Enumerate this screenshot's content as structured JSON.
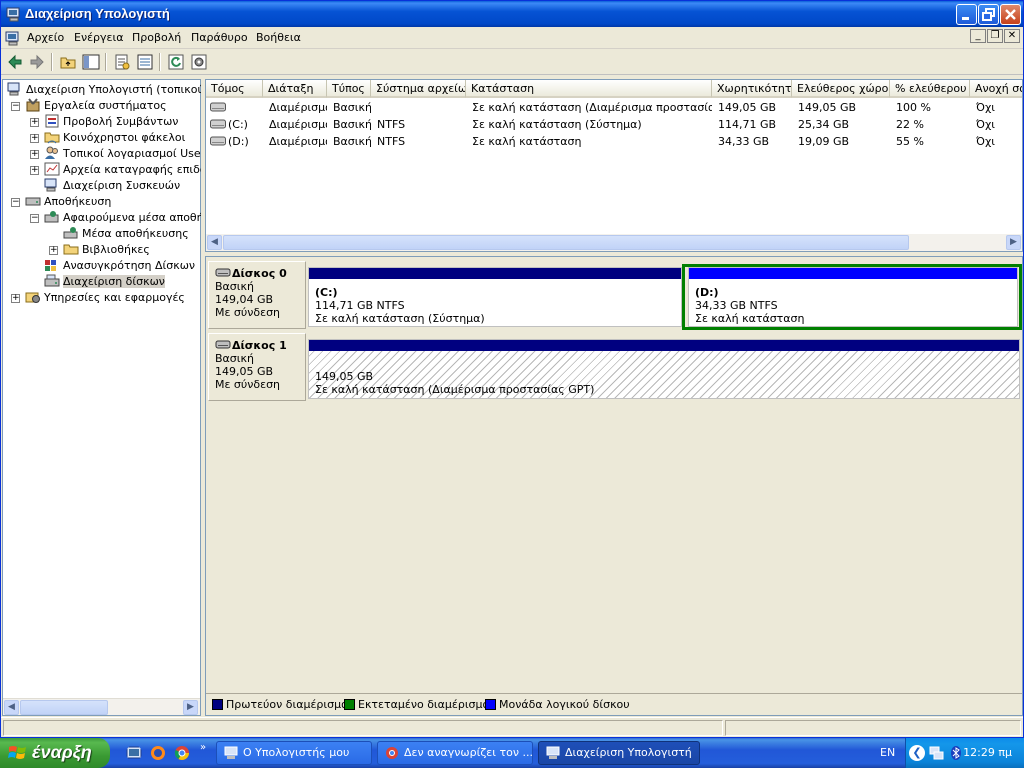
{
  "window": {
    "title": "Διαχείριση Υπολογιστή"
  },
  "menubar": {
    "items": [
      "Αρχείο",
      "Ενέργεια",
      "Προβολή",
      "Παράθυρο",
      "Βοήθεια"
    ]
  },
  "tree": {
    "root": "Διαχείριση Υπολογιστή (τοπικού)",
    "items": [
      "Εργαλεία συστήματος",
      "Προβολή Συμβάντων",
      "Κοινόχρηστοι φάκελοι",
      "Τοπικοί λογαριασμοί Users κ",
      "Αρχεία καταγραφής επιδόσε",
      "Διαχείριση Συσκευών",
      "Αποθήκευση",
      "Αφαιρούμενα μέσα αποθήκε",
      "Μέσα αποθήκευσης",
      "Βιβλιοθήκες",
      "Ανασυγκρότηση Δίσκων",
      "Διαχείριση δίσκων",
      "Υπηρεσίες και εφαρμογές"
    ]
  },
  "volume_list": {
    "columns": [
      "Τόμος",
      "Διάταξη",
      "Τύπος",
      "Σύστημα αρχείων",
      "Κατάσταση",
      "Χωρητικότητα",
      "Ελεύθερος χώρος",
      "% ελεύθερου",
      "Ανοχή σφ"
    ],
    "rows": [
      [
        "",
        "Διαμέρισμα",
        "Βασική",
        "",
        "Σε καλή κατάσταση (Διαμέρισμα προστασίας GPT)",
        "149,05 GB",
        "149,05 GB",
        "100 %",
        "Όχι"
      ],
      [
        "(C:)",
        "Διαμέρισμα",
        "Βασική",
        "NTFS",
        "Σε καλή κατάσταση (Σύστημα)",
        "114,71 GB",
        "25,34 GB",
        "22 %",
        "Όχι"
      ],
      [
        "(D:)",
        "Διαμέρισμα",
        "Βασική",
        "NTFS",
        "Σε καλή κατάσταση",
        "34,33 GB",
        "19,09 GB",
        "55 %",
        "Όχι"
      ]
    ]
  },
  "disks": [
    {
      "name": "Δίσκος 0",
      "type": "Βασική",
      "size": "149,04 GB",
      "status": "Με σύνδεση",
      "partitions": [
        {
          "name": "(C:)",
          "size": "114,71 GB NTFS",
          "status": "Σε καλή κατάσταση (Σύστημα)",
          "bar_color": "#000080"
        },
        {
          "name": "(D:)",
          "size": "34,33 GB NTFS",
          "status": "Σε καλή κατάσταση",
          "bar_color": "#0000ff",
          "frame_color": "#008000"
        }
      ]
    },
    {
      "name": "Δίσκος 1",
      "type": "Βασική",
      "size": "149,05 GB",
      "status": "Με σύνδεση",
      "partitions": [
        {
          "name": "",
          "size": "149,05 GB",
          "status": "Σε καλή κατάσταση (Διαμέρισμα προστασίας GPT)",
          "bar_color": "#000080"
        }
      ]
    }
  ],
  "legend": [
    {
      "label": "Πρωτεύον διαμέρισμα",
      "color": "#000080"
    },
    {
      "label": "Εκτεταμένο διαμέρισμα",
      "color": "#008000"
    },
    {
      "label": "Μονάδα λογικού δίσκου",
      "color": "#0000ff"
    }
  ],
  "taskbar": {
    "start_label": "έναρξη",
    "tasks": [
      "Ο Υπολογιστής μου",
      "Δεν αναγνωρίζει τον ...",
      "Διαχείριση Υπολογιστή"
    ],
    "language": "EN",
    "clock": "12:29 πμ"
  }
}
